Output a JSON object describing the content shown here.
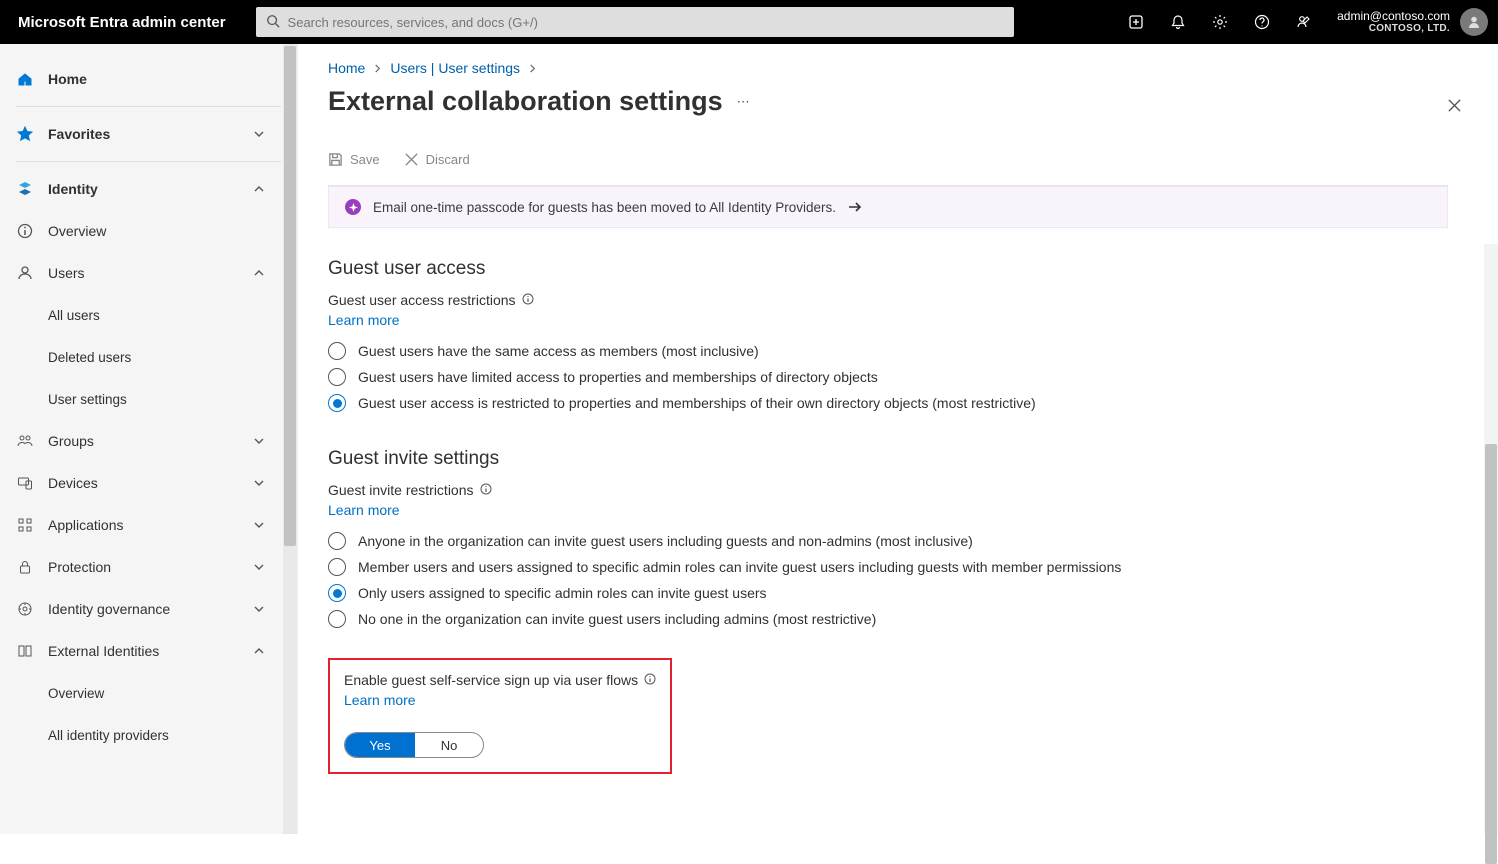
{
  "header": {
    "brand": "Microsoft Entra admin center",
    "search_placeholder": "Search resources, services, and docs (G+/)",
    "account_email": "admin@contoso.com",
    "account_org": "CONTOSO, LTD."
  },
  "sidebar": {
    "home": "Home",
    "favorites": "Favorites",
    "identity": "Identity",
    "overview": "Overview",
    "users": "Users",
    "all_users": "All users",
    "deleted_users": "Deleted users",
    "user_settings": "User settings",
    "groups": "Groups",
    "devices": "Devices",
    "applications": "Applications",
    "protection": "Protection",
    "identity_gov": "Identity governance",
    "external_identities": "External Identities",
    "ext_overview": "Overview",
    "all_identity_providers": "All identity providers"
  },
  "breadcrumb": {
    "home": "Home",
    "users": "Users | User settings"
  },
  "page": {
    "title": "External collaboration settings",
    "save": "Save",
    "discard": "Discard",
    "notice": "Email one-time passcode for guests has been moved to All Identity Providers."
  },
  "guest_access": {
    "title": "Guest user access",
    "sub": "Guest user access restrictions",
    "learn": "Learn more",
    "opt1": "Guest users have the same access as members (most inclusive)",
    "opt2": "Guest users have limited access to properties and memberships of directory objects",
    "opt3": "Guest user access is restricted to properties and memberships of their own directory objects (most restrictive)",
    "selected": 3
  },
  "guest_invite": {
    "title": "Guest invite settings",
    "sub": "Guest invite restrictions",
    "learn": "Learn more",
    "opt1": "Anyone in the organization can invite guest users including guests and non-admins (most inclusive)",
    "opt2": "Member users and users assigned to specific admin roles can invite guest users including guests with member permissions",
    "opt3": "Only users assigned to specific admin roles can invite guest users",
    "opt4": "No one in the organization can invite guest users including admins (most restrictive)",
    "selected": 3
  },
  "self_service": {
    "label": "Enable guest self-service sign up via user flows",
    "learn": "Learn more",
    "yes": "Yes",
    "no": "No",
    "value": "Yes"
  }
}
